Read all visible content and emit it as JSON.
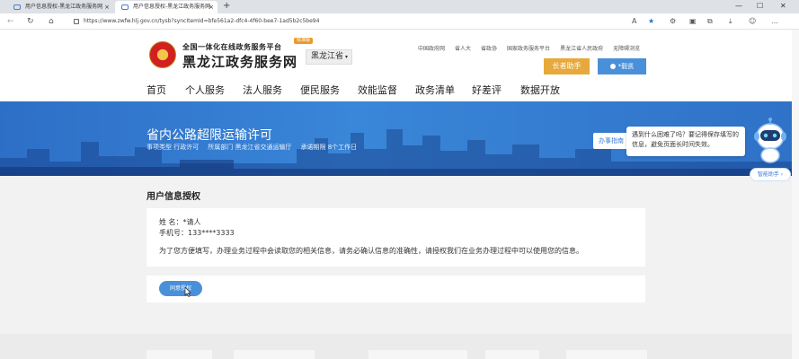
{
  "browser": {
    "tabs": [
      {
        "title": "用户信息授权-黑龙江政务服务网",
        "close": "×"
      },
      {
        "title": "用户信息授权-黑龙江政务服务网",
        "close": "×"
      }
    ],
    "new_tab": "+",
    "window_controls": {
      "minimize": "—",
      "maximize": "☐",
      "close": "✕"
    },
    "url": "https://www.zwfw.hlj.gov.cn/tysb?syncItemId=bfe561a2-dfc4-4f60-bee7-1ad5b2c5be94",
    "toolbar_icons": [
      "reader-icon",
      "favorite-star-icon",
      "extensions-icon",
      "collections-icon",
      "downloads-icon",
      "profile-icon",
      "more-icon"
    ]
  },
  "header": {
    "subtitle": "全国一体化在线政务服务平台",
    "title": "黑龙江政务服务网",
    "badge": "标准版",
    "region": "黑龙江省",
    "top_links": [
      "中国政府网",
      "省人大",
      "省政协",
      "国家政务服务平台",
      "黑龙江省人民政府",
      "无障碍浏览"
    ],
    "elder_button": "长者助手",
    "user_button": "*毅凯"
  },
  "main_nav": [
    "首页",
    "个人服务",
    "法人服务",
    "便民服务",
    "效能监督",
    "政务清单",
    "好差评",
    "数据开放"
  ],
  "banner": {
    "title": "省内公路超限运输许可",
    "meta": [
      "事项类型  行政许可",
      "所属部门  黑龙江省交通运输厅",
      "承诺期限  8个工作日"
    ],
    "guide_button": "办事指南",
    "tooltip": "遇到什么困难了吗？要记得保存填写的信息，避免页面长时间失效。",
    "helper_button": "智能助手 ›"
  },
  "content": {
    "section_title": "用户信息授权",
    "name_label": "姓    名：",
    "name_value": "*请人",
    "phone_label": "手机号：",
    "phone_value": "133****3333",
    "notice": "为了您方便填写，办理业务过程中会读取您的相关信息，请务必确认信息的准确性，请授权我们在业务办理过程中可以使用您的信息。",
    "agree_button": "同意授权"
  },
  "colors": {
    "accent": "#4a90d9",
    "banner": "#2f78d0",
    "elder": "#e7a93b"
  }
}
